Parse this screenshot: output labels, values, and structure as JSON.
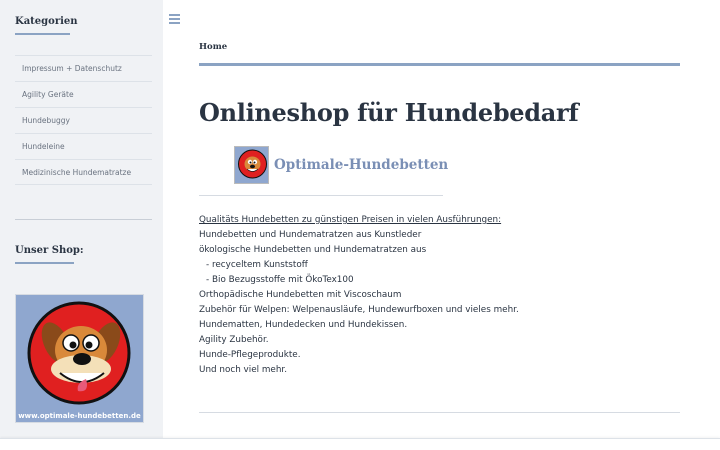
{
  "sidebar": {
    "categories_title": "Kategorien",
    "items": [
      {
        "label": "Impressum + Datenschutz"
      },
      {
        "label": "Agility Geräte"
      },
      {
        "label": "Hundebuggy"
      },
      {
        "label": "Hundeleine"
      },
      {
        "label": "Medizinische Hundematratze"
      }
    ],
    "shop_title": "Unser Shop:",
    "shop_image_caption": "www.optimale-hundebetten.de"
  },
  "breadcrumb": {
    "home": "Home"
  },
  "main": {
    "title": "Onlineshop für Hundebedarf",
    "logo_text": "Optimale-Hundebetten",
    "lines": [
      "Qualitäts Hundebetten zu günstigen Preisen in vielen Ausführungen:",
      "Hundebetten und Hundematratzen aus Kunstleder",
      "ökologische Hundebetten und Hundematratzen aus",
      "- recyceltem Kunststoff",
      "- Bio Bezugsstoffe mit ÖkoTex100",
      "Orthopädische Hundebetten mit Viscoschaum",
      "Zubehör für Welpen: Welpenausläufe, Hundewurfboxen und vieles mehr.",
      "Hundematten, Hundedecken und Hundekissen.",
      "Agility Zubehör.",
      "Hunde-Pflegeprodukte.",
      "Und noch viel mehr."
    ]
  },
  "colors": {
    "accent": "#8ba3c3",
    "heading": "#2a3442",
    "sidebar_bg": "#f0f2f5"
  }
}
